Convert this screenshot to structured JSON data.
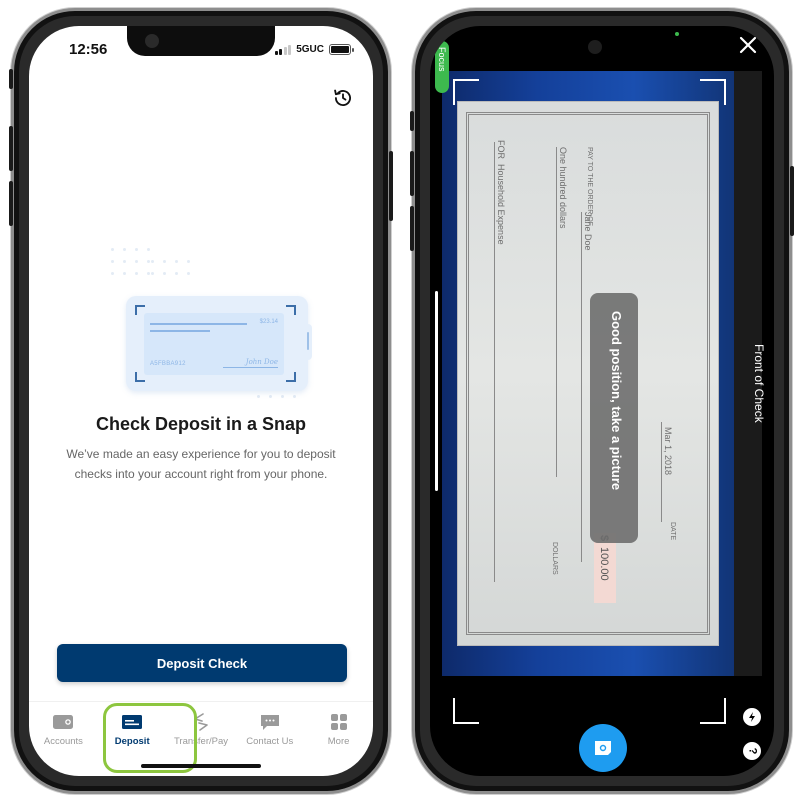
{
  "left_phone": {
    "status_bar": {
      "time": "12:56",
      "network": "5GUC",
      "signal_bars": 2,
      "signal_total": 4,
      "battery_percent": 100
    },
    "history_icon": "history-icon",
    "illustration": {
      "amount": "$23.14",
      "account_code": "A5FBBA912",
      "signature": "John Doe"
    },
    "hero": {
      "title": "Check Deposit in a Snap",
      "description": "We’ve made an easy experience for you to deposit checks into your account right from your phone."
    },
    "primary_button": "Deposit Check",
    "tabs": [
      {
        "label": "Accounts",
        "icon": "wallet-icon",
        "active": false
      },
      {
        "label": "Deposit",
        "icon": "check-card-icon",
        "active": true
      },
      {
        "label": "Transfer/Pay",
        "icon": "transfer-arrows-icon",
        "active": false
      },
      {
        "label": "Contact Us",
        "icon": "chat-bubble-icon",
        "active": false
      },
      {
        "label": "More",
        "icon": "grid-icon",
        "active": false
      }
    ],
    "highlight_color": "#8dc63f",
    "brand_color": "#003a70"
  },
  "right_phone": {
    "focus_label": "Focus",
    "toast": "Good position, take a picture",
    "side_label": "Front of Check",
    "check": {
      "pay_to_label": "PAY TO THE ORDER OF",
      "payee": "Jane Doe",
      "amount_words": "One hundred dollars",
      "memo_label": "FOR",
      "memo": "Household Expense",
      "date": "Mar 1, 2018",
      "date_label": "DATE",
      "amount": "100.00",
      "currency": "$",
      "dollars_label": "DOLLARS"
    },
    "buttons": {
      "close": "close-icon",
      "shutter": "camera-icon",
      "flash": "flash-icon",
      "help": "?"
    },
    "accent_color": "#1e9cf0",
    "focus_color": "#3dba4e"
  }
}
